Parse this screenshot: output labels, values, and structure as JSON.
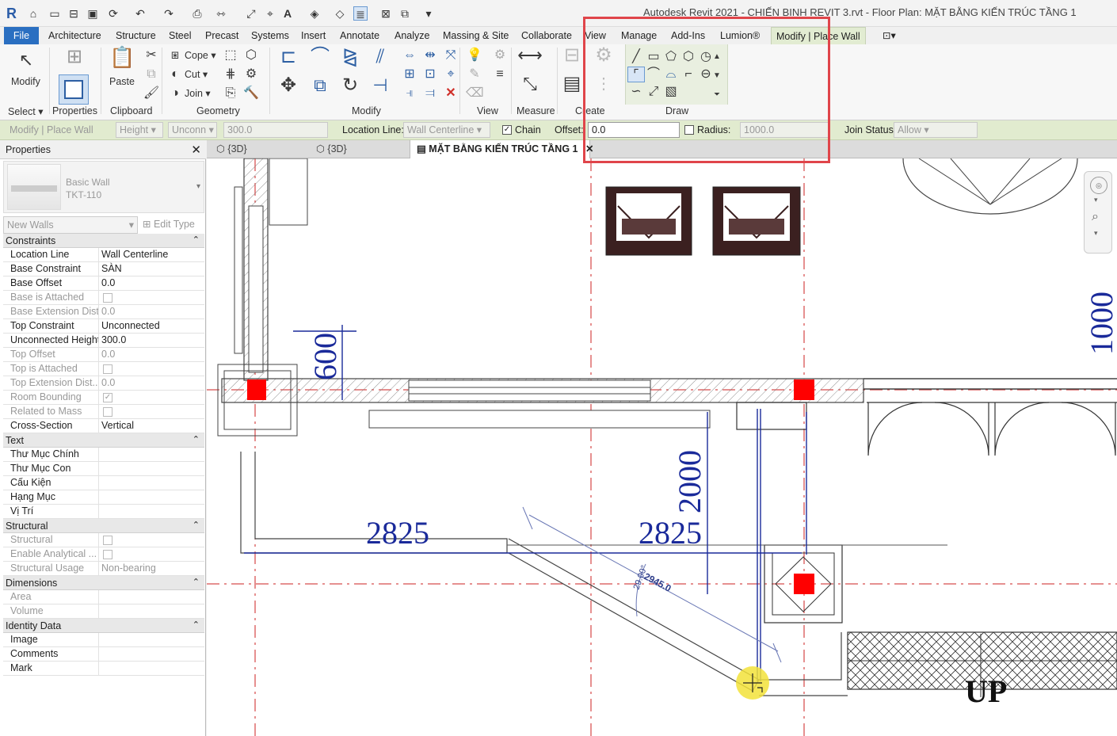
{
  "window_title": "Autodesk Revit 2021 - CHIẾN BINH REVIT 3.rvt - Floor Plan: MẶT BẰNG KIẾN TRÚC TẦNG 1",
  "app_logo": "R",
  "ribbon_tabs": [
    "File",
    "Architecture",
    "Structure",
    "Steel",
    "Precast",
    "Systems",
    "Insert",
    "Annotate",
    "Analyze",
    "Massing & Site",
    "Collaborate",
    "View",
    "Manage",
    "Add-Ins",
    "Lumion®",
    "Modify | Place Wall"
  ],
  "ribbon": {
    "select_label": "Select",
    "modify_label": "Modify",
    "properties_label": "Properties",
    "paste_label": "Paste",
    "clipboard_label": "Clipboard",
    "cope_label": "Cope",
    "cut_label": "Cut",
    "join_label": "Join",
    "geometry_label": "Geometry",
    "modify_panel_label": "Modify",
    "view_label": "View",
    "measure_label": "Measure",
    "create_label": "Create",
    "draw_label": "Draw"
  },
  "options_bar": {
    "context": "Modify | Place Wall",
    "height_mode": "Height",
    "top_constraint": "Unconn",
    "height_value": "300.0",
    "location_line_label": "Location Line:",
    "location_line_value": "Wall Centerline",
    "chain_label": "Chain",
    "offset_label": "Offset:",
    "offset_value": "0.0",
    "radius_label": "Radius:",
    "radius_value": "1000.0",
    "join_status_label": "Join Status:",
    "join_status_value": "Allow"
  },
  "properties": {
    "title": "Properties",
    "type_family": "Basic Wall",
    "type_name": "TKT-110",
    "instance_filter": "New Walls",
    "edit_type": "Edit Type",
    "groups": [
      {
        "name": "Constraints",
        "rows": [
          {
            "name": "Location Line",
            "value": "Wall Centerline",
            "dim": false
          },
          {
            "name": "Base Constraint",
            "value": "SÀN",
            "dim": false
          },
          {
            "name": "Base Offset",
            "value": "0.0",
            "dim": false
          },
          {
            "name": "Base is Attached",
            "value": "",
            "dim": true,
            "check": ""
          },
          {
            "name": "Base Extension Dist...",
            "value": "0.0",
            "dim": true
          },
          {
            "name": "Top Constraint",
            "value": "Unconnected",
            "dim": false
          },
          {
            "name": "Unconnected Height",
            "value": "300.0",
            "dim": false
          },
          {
            "name": "Top Offset",
            "value": "0.0",
            "dim": true
          },
          {
            "name": "Top is Attached",
            "value": "",
            "dim": true,
            "check": ""
          },
          {
            "name": "Top Extension Dist...",
            "value": "0.0",
            "dim": true
          },
          {
            "name": "Room Bounding",
            "value": "",
            "dim": true,
            "check": "✓"
          },
          {
            "name": "Related to Mass",
            "value": "",
            "dim": true,
            "check": ""
          },
          {
            "name": "Cross-Section",
            "value": "Vertical",
            "dim": false
          }
        ]
      },
      {
        "name": "Text",
        "rows": [
          {
            "name": "Thư Mục Chính",
            "value": "",
            "dim": false
          },
          {
            "name": "Thư Mục Con",
            "value": "",
            "dim": false
          },
          {
            "name": "Cấu Kiện",
            "value": "",
            "dim": false
          },
          {
            "name": "Hạng Mục",
            "value": "",
            "dim": false
          },
          {
            "name": "Vị Trí",
            "value": "",
            "dim": false
          }
        ]
      },
      {
        "name": "Structural",
        "rows": [
          {
            "name": "Structural",
            "value": "",
            "dim": true,
            "check": ""
          },
          {
            "name": "Enable Analytical ...",
            "value": "",
            "dim": true,
            "check": ""
          },
          {
            "name": "Structural Usage",
            "value": "Non-bearing",
            "dim": true
          }
        ]
      },
      {
        "name": "Dimensions",
        "rows": [
          {
            "name": "Area",
            "value": "",
            "dim": true
          },
          {
            "name": "Volume",
            "value": "",
            "dim": true
          }
        ]
      },
      {
        "name": "Identity Data",
        "rows": [
          {
            "name": "Image",
            "value": "",
            "dim": false
          },
          {
            "name": "Comments",
            "value": "",
            "dim": false
          },
          {
            "name": "Mark",
            "value": "",
            "dim": false
          }
        ]
      }
    ]
  },
  "view_tabs": [
    "{3D}",
    "{3D}",
    "MẶT BẰNG KIẾN TRÚC TẦNG 1"
  ],
  "drawing": {
    "dim_600": "600",
    "dim_1000": "1000",
    "dim_2000": "2000",
    "dim_2825_left": "2825",
    "dim_2825_right": "2825",
    "temp_angle": "29.00°",
    "temp_length": "2945.0",
    "stair_label": "UP"
  },
  "colors": {
    "file_tab": "#2a6fc1",
    "context_tab": "#e2ecd2",
    "options_bar": "#e1ebcf",
    "highlight_box": "#e0454a",
    "dimension_blue": "#1a2a9a",
    "column_red": "#ff0000",
    "gridline_red": "#cc2222",
    "cursor_yellow": "#f2e23a"
  }
}
